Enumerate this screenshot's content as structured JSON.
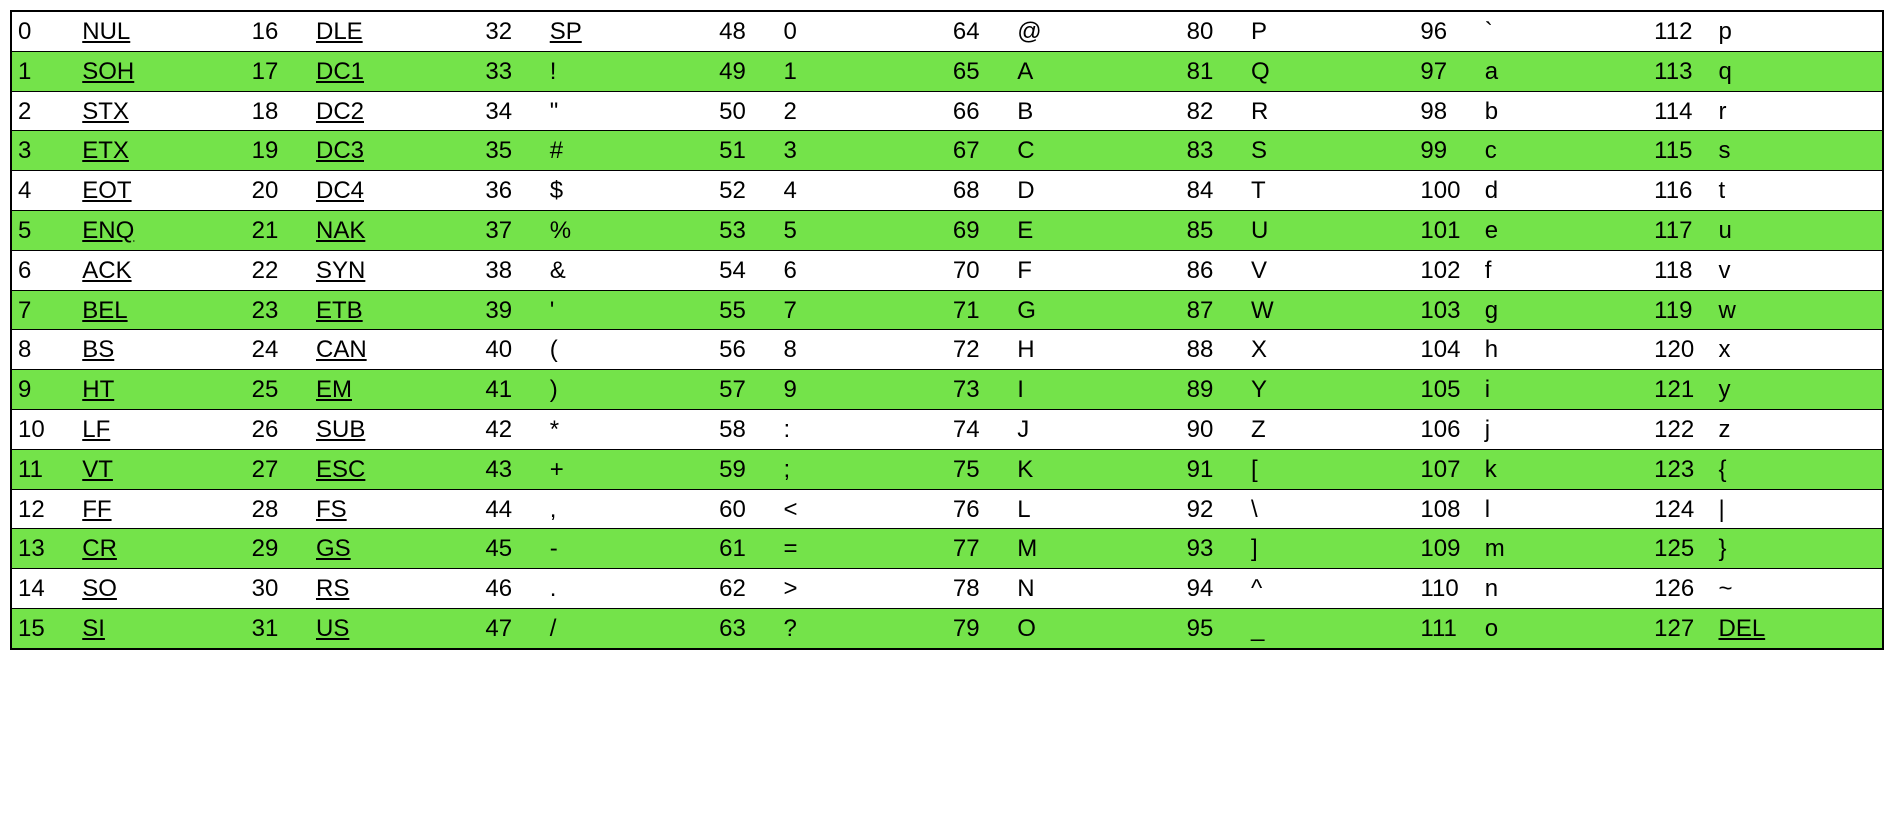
{
  "table": {
    "columns": 8,
    "rows": 16,
    "entries": [
      {
        "code": 0,
        "char": "NUL",
        "link": true
      },
      {
        "code": 1,
        "char": "SOH",
        "link": true
      },
      {
        "code": 2,
        "char": "STX",
        "link": true
      },
      {
        "code": 3,
        "char": "ETX",
        "link": true
      },
      {
        "code": 4,
        "char": "EOT",
        "link": true
      },
      {
        "code": 5,
        "char": "ENQ",
        "link": true
      },
      {
        "code": 6,
        "char": "ACK",
        "link": true
      },
      {
        "code": 7,
        "char": "BEL",
        "link": true
      },
      {
        "code": 8,
        "char": "BS",
        "link": true
      },
      {
        "code": 9,
        "char": "HT",
        "link": true
      },
      {
        "code": 10,
        "char": "LF",
        "link": true
      },
      {
        "code": 11,
        "char": "VT",
        "link": true
      },
      {
        "code": 12,
        "char": "FF",
        "link": true
      },
      {
        "code": 13,
        "char": "CR",
        "link": true
      },
      {
        "code": 14,
        "char": "SO",
        "link": true
      },
      {
        "code": 15,
        "char": "SI",
        "link": true
      },
      {
        "code": 16,
        "char": "DLE",
        "link": true
      },
      {
        "code": 17,
        "char": "DC1",
        "link": true
      },
      {
        "code": 18,
        "char": "DC2",
        "link": true
      },
      {
        "code": 19,
        "char": "DC3",
        "link": true
      },
      {
        "code": 20,
        "char": "DC4",
        "link": true
      },
      {
        "code": 21,
        "char": "NAK",
        "link": true
      },
      {
        "code": 22,
        "char": "SYN",
        "link": true
      },
      {
        "code": 23,
        "char": "ETB",
        "link": true
      },
      {
        "code": 24,
        "char": "CAN",
        "link": true
      },
      {
        "code": 25,
        "char": "EM",
        "link": true
      },
      {
        "code": 26,
        "char": "SUB",
        "link": true
      },
      {
        "code": 27,
        "char": "ESC",
        "link": true
      },
      {
        "code": 28,
        "char": "FS",
        "link": true
      },
      {
        "code": 29,
        "char": "GS",
        "link": true
      },
      {
        "code": 30,
        "char": "RS",
        "link": true
      },
      {
        "code": 31,
        "char": "US",
        "link": true
      },
      {
        "code": 32,
        "char": "SP",
        "link": true
      },
      {
        "code": 33,
        "char": "!",
        "link": false
      },
      {
        "code": 34,
        "char": "\"",
        "link": false
      },
      {
        "code": 35,
        "char": "#",
        "link": false
      },
      {
        "code": 36,
        "char": "$",
        "link": false
      },
      {
        "code": 37,
        "char": "%",
        "link": false
      },
      {
        "code": 38,
        "char": "&",
        "link": false
      },
      {
        "code": 39,
        "char": "'",
        "link": false
      },
      {
        "code": 40,
        "char": "(",
        "link": false
      },
      {
        "code": 41,
        "char": ")",
        "link": false
      },
      {
        "code": 42,
        "char": "*",
        "link": false
      },
      {
        "code": 43,
        "char": "+",
        "link": false
      },
      {
        "code": 44,
        "char": ",",
        "link": false
      },
      {
        "code": 45,
        "char": "-",
        "link": false
      },
      {
        "code": 46,
        "char": ".",
        "link": false
      },
      {
        "code": 47,
        "char": "/",
        "link": false
      },
      {
        "code": 48,
        "char": "0",
        "link": false
      },
      {
        "code": 49,
        "char": "1",
        "link": false
      },
      {
        "code": 50,
        "char": "2",
        "link": false
      },
      {
        "code": 51,
        "char": "3",
        "link": false
      },
      {
        "code": 52,
        "char": "4",
        "link": false
      },
      {
        "code": 53,
        "char": "5",
        "link": false
      },
      {
        "code": 54,
        "char": "6",
        "link": false
      },
      {
        "code": 55,
        "char": "7",
        "link": false
      },
      {
        "code": 56,
        "char": "8",
        "link": false
      },
      {
        "code": 57,
        "char": "9",
        "link": false
      },
      {
        "code": 58,
        "char": ":",
        "link": false
      },
      {
        "code": 59,
        "char": ";",
        "link": false
      },
      {
        "code": 60,
        "char": "<",
        "link": false
      },
      {
        "code": 61,
        "char": "=",
        "link": false
      },
      {
        "code": 62,
        "char": ">",
        "link": false
      },
      {
        "code": 63,
        "char": "?",
        "link": false
      },
      {
        "code": 64,
        "char": "@",
        "link": false
      },
      {
        "code": 65,
        "char": "A",
        "link": false
      },
      {
        "code": 66,
        "char": "B",
        "link": false
      },
      {
        "code": 67,
        "char": "C",
        "link": false
      },
      {
        "code": 68,
        "char": "D",
        "link": false
      },
      {
        "code": 69,
        "char": "E",
        "link": false
      },
      {
        "code": 70,
        "char": "F",
        "link": false
      },
      {
        "code": 71,
        "char": "G",
        "link": false
      },
      {
        "code": 72,
        "char": "H",
        "link": false
      },
      {
        "code": 73,
        "char": "I",
        "link": false
      },
      {
        "code": 74,
        "char": "J",
        "link": false
      },
      {
        "code": 75,
        "char": "K",
        "link": false
      },
      {
        "code": 76,
        "char": "L",
        "link": false
      },
      {
        "code": 77,
        "char": "M",
        "link": false
      },
      {
        "code": 78,
        "char": "N",
        "link": false
      },
      {
        "code": 79,
        "char": "O",
        "link": false
      },
      {
        "code": 80,
        "char": "P",
        "link": false
      },
      {
        "code": 81,
        "char": "Q",
        "link": false
      },
      {
        "code": 82,
        "char": "R",
        "link": false
      },
      {
        "code": 83,
        "char": "S",
        "link": false
      },
      {
        "code": 84,
        "char": "T",
        "link": false
      },
      {
        "code": 85,
        "char": "U",
        "link": false
      },
      {
        "code": 86,
        "char": "V",
        "link": false
      },
      {
        "code": 87,
        "char": "W",
        "link": false
      },
      {
        "code": 88,
        "char": "X",
        "link": false
      },
      {
        "code": 89,
        "char": "Y",
        "link": false
      },
      {
        "code": 90,
        "char": "Z",
        "link": false
      },
      {
        "code": 91,
        "char": "[",
        "link": false
      },
      {
        "code": 92,
        "char": "\\",
        "link": false
      },
      {
        "code": 93,
        "char": "]",
        "link": false
      },
      {
        "code": 94,
        "char": "^",
        "link": false
      },
      {
        "code": 95,
        "char": "_",
        "link": false
      },
      {
        "code": 96,
        "char": "`",
        "link": false
      },
      {
        "code": 97,
        "char": "a",
        "link": false
      },
      {
        "code": 98,
        "char": "b",
        "link": false
      },
      {
        "code": 99,
        "char": "c",
        "link": false
      },
      {
        "code": 100,
        "char": "d",
        "link": false
      },
      {
        "code": 101,
        "char": "e",
        "link": false
      },
      {
        "code": 102,
        "char": "f",
        "link": false
      },
      {
        "code": 103,
        "char": "g",
        "link": false
      },
      {
        "code": 104,
        "char": "h",
        "link": false
      },
      {
        "code": 105,
        "char": "i",
        "link": false
      },
      {
        "code": 106,
        "char": "j",
        "link": false
      },
      {
        "code": 107,
        "char": "k",
        "link": false
      },
      {
        "code": 108,
        "char": "l",
        "link": false
      },
      {
        "code": 109,
        "char": "m",
        "link": false
      },
      {
        "code": 110,
        "char": "n",
        "link": false
      },
      {
        "code": 111,
        "char": "o",
        "link": false
      },
      {
        "code": 112,
        "char": "p",
        "link": false
      },
      {
        "code": 113,
        "char": "q",
        "link": false
      },
      {
        "code": 114,
        "char": "r",
        "link": false
      },
      {
        "code": 115,
        "char": "s",
        "link": false
      },
      {
        "code": 116,
        "char": "t",
        "link": false
      },
      {
        "code": 117,
        "char": "u",
        "link": false
      },
      {
        "code": 118,
        "char": "v",
        "link": false
      },
      {
        "code": 119,
        "char": "w",
        "link": false
      },
      {
        "code": 120,
        "char": "x",
        "link": false
      },
      {
        "code": 121,
        "char": "y",
        "link": false
      },
      {
        "code": 122,
        "char": "z",
        "link": false
      },
      {
        "code": 123,
        "char": "{",
        "link": false
      },
      {
        "code": 124,
        "char": "|",
        "link": false
      },
      {
        "code": 125,
        "char": "}",
        "link": false
      },
      {
        "code": 126,
        "char": "~",
        "link": false
      },
      {
        "code": 127,
        "char": "DEL",
        "link": true
      }
    ]
  },
  "colors": {
    "stripe_odd": "#74e34a",
    "stripe_even": "#ffffff",
    "border": "#000000"
  }
}
